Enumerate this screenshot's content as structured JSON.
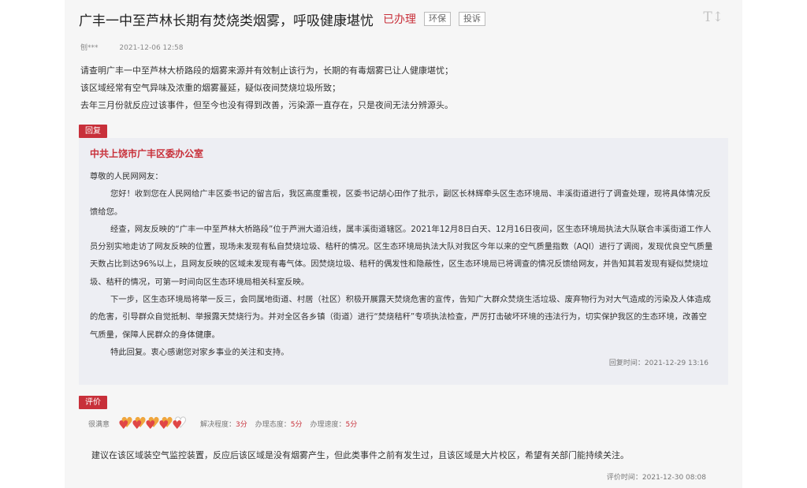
{
  "header": {
    "title": "广丰一中至芦林长期有焚烧类烟雾，呼吸健康堪忧",
    "status": "已办理",
    "tags": [
      "环保",
      "投诉"
    ],
    "font_toggle": "T↕"
  },
  "meta": {
    "author": "刨***",
    "time": "2021-12-06 12:58"
  },
  "content": [
    "请查明广丰一中至芦林大桥路段的烟雾来源并有效制止该行为，长期的有毒烟雾已让人健康堪忧；",
    "该区域经常有空气异味及浓重的烟雾蔓延，疑似夜间焚烧垃圾所致；",
    "去年三月份就反应过该事件，但至今也没有得到改善，污染源一直存在，只是夜间无法分辨源头。"
  ],
  "reply": {
    "label": "回复",
    "org": "中共上饶市广丰区委办公室",
    "greeting": "尊敬的人民网网友：",
    "paragraphs": [
      "您好！收到您在人民网给广丰区委书记的留言后，我区高度重视，区委书记胡心田作了批示，副区长林辉牵头区生态环境局、丰溪街道进行了调查处理，现将具体情况反馈给您。",
      "经查，网友反映的“广丰一中至芦林大桥路段”位于芦洲大道沿线，属丰溪街道辖区。2021年12月8日白天、12月16日夜间，区生态环境局执法大队联合丰溪街道工作人员分别实地走访了网友反映的位置，现场未发现有私自焚烧垃圾、秸秆的情况。区生态环境局执法大队对我区今年以来的空气质量指数（AQI）进行了调阅，发现优良空气质量天数占比到达96%以上，且网友反映的区域未发现有毒气体。因焚烧垃圾、秸秆的偶发性和隐蔽性，区生态环境局已将调查的情况反馈给网友，并告知其若发现有疑似焚烧垃圾、秸秆的情况，可第一时间向区生态环境局相关科室反映。",
      "下一步，区生态环境局将举一反三，会同属地街道、村居（社区）积极开展露天焚烧危害的宣传，告知广大群众焚烧生活垃圾、废弃物行为对大气造成的污染及人体造成的危害，引导群众自觉抵制、举报露天焚烧行为。并对全区各乡镇（街道）进行“焚烧秸秆”专项执法检查，严厉打击破坏环境的违法行为，切实保护我区的生态环境，改善空气质量，保障人民群众的身体健康。",
      "特此回复。衷心感谢您对家乡事业的关注和支持。"
    ],
    "time": "回复时间：2021-12-29 13:16"
  },
  "evaluation": {
    "label": "评价",
    "satisfaction": "很满意",
    "hearts_filled": 4,
    "hearts_total": 5,
    "scores": [
      {
        "label": "解决程度：",
        "value": "3分"
      },
      {
        "label": "办理态度：",
        "value": "5分"
      },
      {
        "label": "办理速度：",
        "value": "5分"
      }
    ],
    "comment": "建议在该区域装空气监控装置，反应后该区域是没有烟雾产生，但此类事件之前有发生过，且该区域是大片校区，希望有关部门能持续关注。",
    "time": "评价时间：2021-12-30 08:08"
  },
  "colors": {
    "accent": "#c8303a",
    "reply_bg": "#edeef3",
    "page_bg": "#f6f6f6",
    "heart_gold": "#f0a63d",
    "heart_red": "#e04646"
  }
}
